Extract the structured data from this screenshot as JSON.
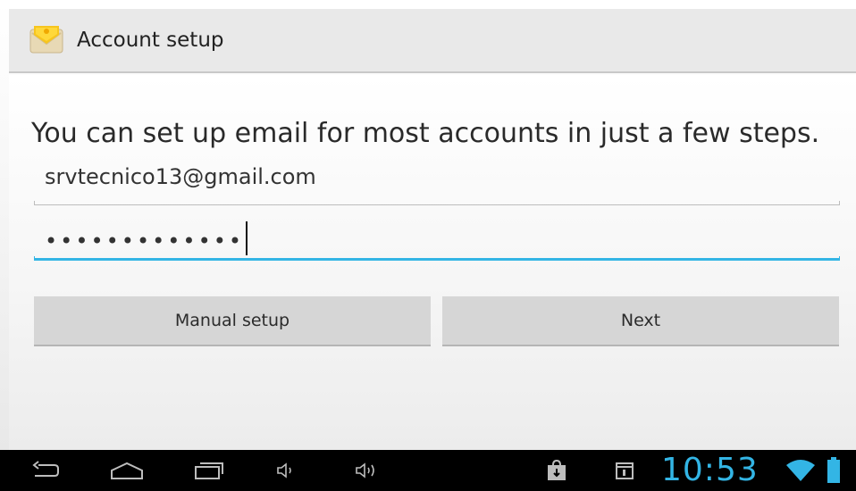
{
  "action_bar": {
    "title": "Account setup",
    "icon": "email-envelope-icon"
  },
  "form": {
    "instructions": "You can set up email for most accounts in just a few steps.",
    "email_value": "srvtecnico13@gmail.com",
    "password_mask": "•••••••••••••"
  },
  "buttons": {
    "manual_setup": "Manual setup",
    "next": "Next"
  },
  "status_bar": {
    "time": "10:53",
    "icons": [
      "back-icon",
      "home-icon",
      "recent-apps-icon",
      "volume-down-icon",
      "volume-up-icon",
      "store-bag-icon",
      "calendar-icon",
      "wifi-icon",
      "battery-icon"
    ]
  },
  "colors": {
    "accent": "#33b5e5",
    "button_bg": "#d6d6d6",
    "action_bar_bg": "#e9e9e9",
    "nav_bg": "#000000"
  }
}
